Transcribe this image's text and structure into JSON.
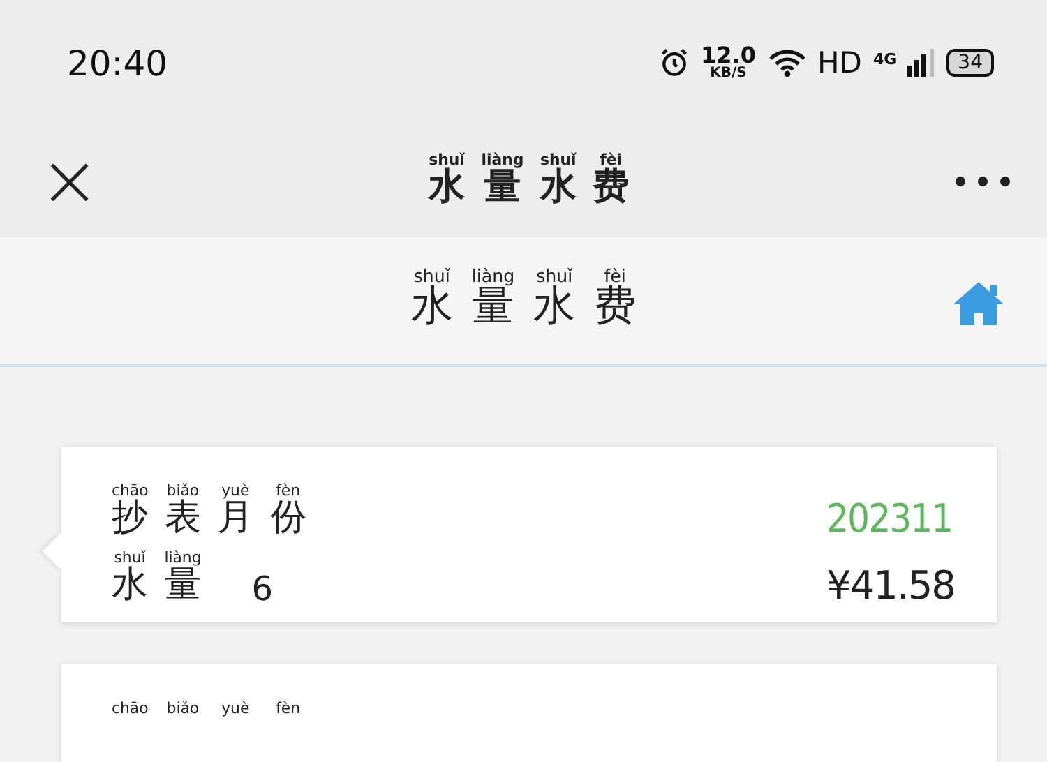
{
  "status_bar": {
    "time": "20:40",
    "speed": "12.0",
    "speed_unit": "KB/S",
    "hd": "HD",
    "network": "4G",
    "battery": "34"
  },
  "nav_bar": {
    "close": "×",
    "title": [
      {
        "char": "水",
        "pinyin": "shuǐ"
      },
      {
        "char": "量",
        "pinyin": "liàng"
      },
      {
        "char": "水",
        "pinyin": "shuǐ"
      },
      {
        "char": "费",
        "pinyin": "fèi"
      }
    ]
  },
  "header": {
    "title": [
      {
        "char": "水",
        "pinyin": "shuǐ"
      },
      {
        "char": "量",
        "pinyin": "liàng"
      },
      {
        "char": "水",
        "pinyin": "shuǐ"
      },
      {
        "char": "费",
        "pinyin": "fèi"
      }
    ]
  },
  "records": [
    {
      "month_label": [
        {
          "char": "抄",
          "pinyin": "chāo"
        },
        {
          "char": "表",
          "pinyin": "biǎo"
        },
        {
          "char": "月",
          "pinyin": "yuè"
        },
        {
          "char": "份",
          "pinyin": "fèn"
        }
      ],
      "month": "202311",
      "usage_label": [
        {
          "char": "水",
          "pinyin": "shuǐ"
        },
        {
          "char": "量",
          "pinyin": "liàng"
        }
      ],
      "usage": "6",
      "fee": "¥41.58"
    },
    {
      "month_label": [
        {
          "pinyin": "chāo"
        },
        {
          "pinyin": "biǎo"
        },
        {
          "pinyin": "yuè"
        },
        {
          "pinyin": "fèn"
        }
      ]
    }
  ]
}
